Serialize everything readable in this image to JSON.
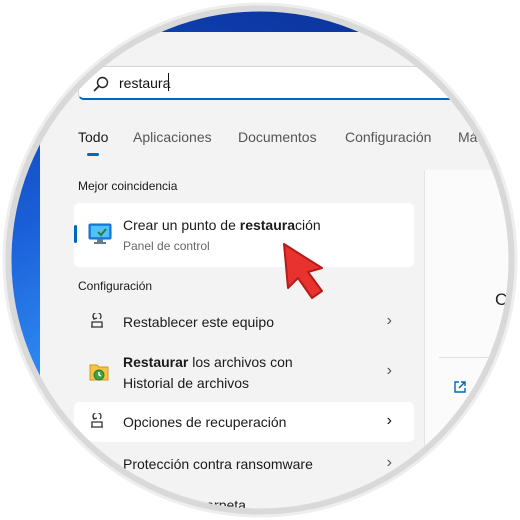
{
  "search": {
    "value": "restaura"
  },
  "tabs": [
    {
      "label": "Todo"
    },
    {
      "label": "Aplicaciones"
    },
    {
      "label": "Documentos"
    },
    {
      "label": "Configuración"
    },
    {
      "label": "Más"
    }
  ],
  "best_match": {
    "section_label": "Mejor coincidencia",
    "title_prefix": "Crear un punto de ",
    "title_bold": "restaura",
    "title_suffix": "ción",
    "subtitle": "Panel de control",
    "icon": "computer-restore-icon"
  },
  "settings": {
    "section_label": "Configuración",
    "items": [
      {
        "label": "Restablecer este equipo",
        "icon": "reset-pc-icon"
      },
      {
        "label_bold": "Restaurar",
        "label_rest": " los archivos con",
        "label_line2": "Historial de archivos",
        "icon": "file-history-icon"
      },
      {
        "label": "Opciones de recuperación",
        "icon": "recovery-icon"
      },
      {
        "label": "Protección contra ransomware",
        "icon": "shield-icon"
      },
      {
        "label": "Acceso a la carpeta",
        "icon": "folder-icon"
      }
    ]
  },
  "preview": {
    "title": "Cr"
  },
  "colors": {
    "accent": "#0067c0",
    "cursor": "#e8322e"
  }
}
